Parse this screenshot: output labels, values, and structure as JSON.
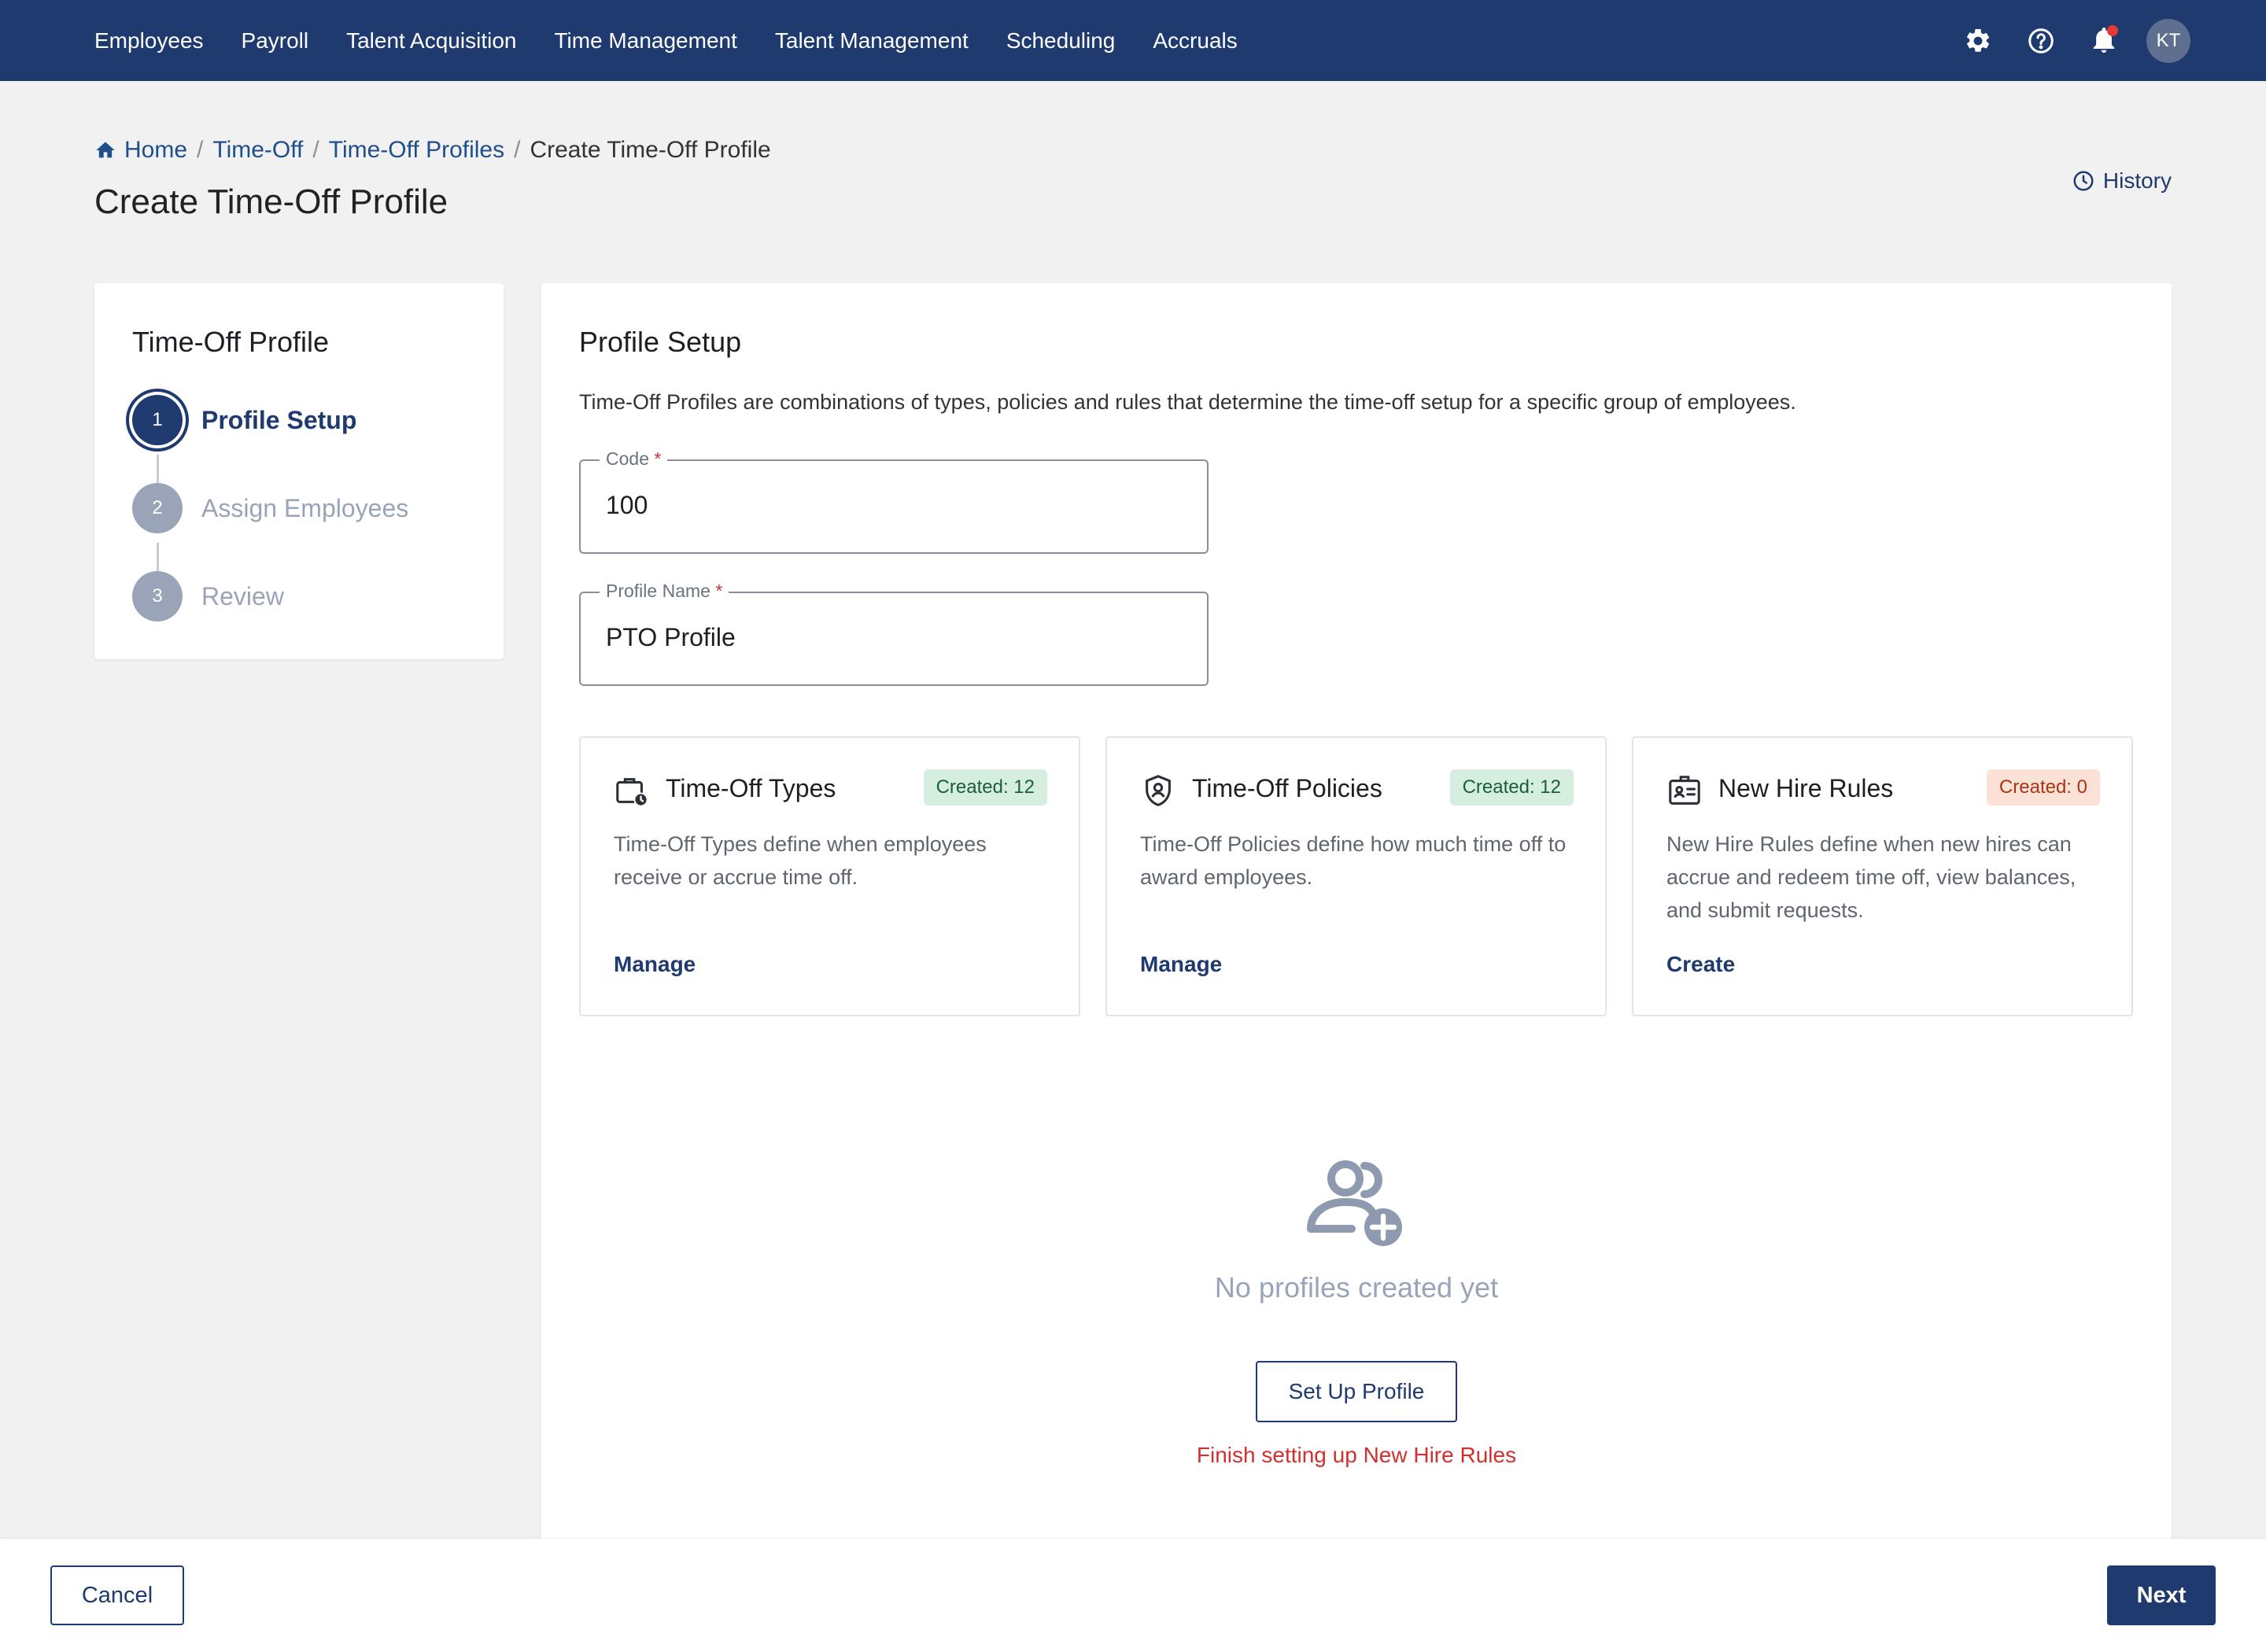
{
  "nav": {
    "items": [
      {
        "label": "Employees"
      },
      {
        "label": "Payroll"
      },
      {
        "label": "Talent Acquisition"
      },
      {
        "label": "Time Management"
      },
      {
        "label": "Talent Management"
      },
      {
        "label": "Scheduling"
      },
      {
        "label": "Accruals"
      }
    ],
    "icons": [
      "gear-icon",
      "help-icon",
      "bell-icon"
    ],
    "avatar_initials": "KT",
    "notification_dot_color": "#e53935"
  },
  "breadcrumb": {
    "items": [
      {
        "label": "Home",
        "icon": "home-icon"
      },
      {
        "label": "Time-Off"
      },
      {
        "label": "Time-Off Profiles"
      }
    ],
    "current": "Create Time-Off Profile",
    "separator": "/"
  },
  "page": {
    "title": "Create Time-Off Profile",
    "history_label": "History"
  },
  "stepper": {
    "title": "Time-Off Profile",
    "steps": [
      {
        "number": "1",
        "label": "Profile Setup",
        "state": "active"
      },
      {
        "number": "2",
        "label": "Assign Employees",
        "state": "pending"
      },
      {
        "number": "3",
        "label": "Review",
        "state": "pending"
      }
    ]
  },
  "setup": {
    "title": "Profile Setup",
    "description": "Time-Off Profiles are combinations of types, policies and rules that determine the time-off setup for a specific group of employees.",
    "fields": {
      "code": {
        "label": "Code",
        "required_mark": "*",
        "value": "100"
      },
      "profile_name": {
        "label": "Profile Name",
        "required_mark": "*",
        "value": "PTO Profile"
      }
    },
    "cards": [
      {
        "title": "Time-Off Types",
        "icon": "briefcase-clock-icon",
        "badge": "Created: 12",
        "badge_tone": "green",
        "description": "Time-Off Types define when employees receive or accrue time off.",
        "action": "Manage"
      },
      {
        "title": "Time-Off Policies",
        "icon": "shield-user-icon",
        "badge": "Created: 12",
        "badge_tone": "green",
        "description": "Time-Off Policies define how much time off to award employees.",
        "action": "Manage"
      },
      {
        "title": "New Hire Rules",
        "icon": "id-badge-icon",
        "badge": "Created: 0",
        "badge_tone": "red",
        "description": "New Hire Rules define when new hires can accrue and redeem time off, view balances, and submit requests.",
        "action": "Create"
      }
    ],
    "empty_state": {
      "icon": "users-add-icon",
      "message": "No profiles created yet",
      "button": "Set Up Profile",
      "warning": "Finish setting up New Hire Rules"
    }
  },
  "footer": {
    "cancel_label": "Cancel",
    "next_label": "Next"
  },
  "colors": {
    "primary": "#1e3a6e",
    "link": "#1e4f8a",
    "error": "#d32f2f",
    "muted": "#9aa4b8"
  }
}
